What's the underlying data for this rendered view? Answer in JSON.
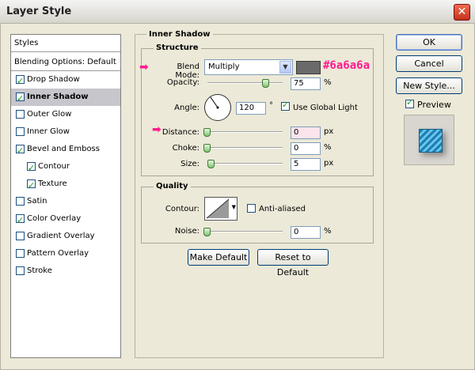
{
  "window": {
    "title": "Layer Style"
  },
  "colors": {
    "shadow_color": "#6a6a6a",
    "annotation": "#ff1a90",
    "check_green": "#21a121"
  },
  "left_panel": {
    "items": [
      {
        "label": "Styles",
        "checkbox": null
      },
      {
        "label": "Blending Options: Default",
        "checkbox": null
      },
      {
        "label": "Drop Shadow",
        "checkbox": true
      },
      {
        "label": "Inner Shadow",
        "checkbox": true,
        "selected": true
      },
      {
        "label": "Outer Glow",
        "checkbox": false
      },
      {
        "label": "Inner Glow",
        "checkbox": false
      },
      {
        "label": "Bevel and Emboss",
        "checkbox": true
      },
      {
        "label": "Contour",
        "checkbox": true,
        "indent": true
      },
      {
        "label": "Texture",
        "checkbox": true,
        "indent": true
      },
      {
        "label": "Satin",
        "checkbox": false
      },
      {
        "label": "Color Overlay",
        "checkbox": true
      },
      {
        "label": "Gradient Overlay",
        "checkbox": false
      },
      {
        "label": "Pattern Overlay",
        "checkbox": false
      },
      {
        "label": "Stroke",
        "checkbox": false
      }
    ]
  },
  "inner_shadow": {
    "title": "Inner Shadow",
    "structure": {
      "title": "Structure",
      "blend_mode_label": "Blend Mode:",
      "blend_mode_value": "Multiply",
      "color_annotation": "#6a6a6a",
      "opacity_label": "Opacity:",
      "opacity_value": "75",
      "opacity_unit": "%",
      "opacity_level": 0.75,
      "angle_label": "Angle:",
      "angle_value": "120",
      "angle_unit": "°",
      "use_global_light_label": "Use Global Light",
      "use_global_light": true,
      "distance_label": "Distance:",
      "distance_value": "0",
      "distance_unit": "px",
      "choke_label": "Choke:",
      "choke_value": "0",
      "choke_unit": "%",
      "size_label": "Size:",
      "size_value": "5",
      "size_unit": "px"
    },
    "quality": {
      "title": "Quality",
      "contour_label": "Contour:",
      "anti_aliased_label": "Anti-aliased",
      "anti_aliased": false,
      "noise_label": "Noise:",
      "noise_value": "0",
      "noise_unit": "%"
    },
    "make_default_label": "Make Default",
    "reset_default_label": "Reset to Default"
  },
  "buttons": {
    "ok": "OK",
    "cancel": "Cancel",
    "new_style": "New Style...",
    "preview_label": "Preview",
    "preview_checked": true
  }
}
